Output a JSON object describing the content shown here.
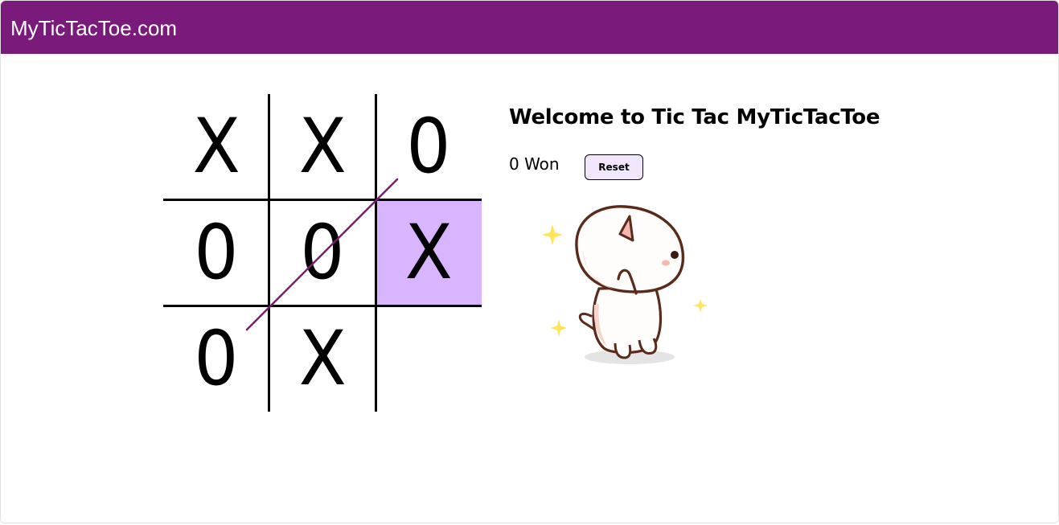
{
  "header": {
    "site_title": "MyTicTacToe.com"
  },
  "board": {
    "cells": [
      "X",
      "X",
      "0",
      "0",
      "0",
      "X",
      "0",
      "X",
      ""
    ],
    "highlighted_cell": 5,
    "winning_line": "diagonal from top-right to bottom-left"
  },
  "panel": {
    "welcome_text": "Welcome to Tic Tac MyTicTacToe",
    "status_text": "0 Won",
    "reset_label": "Reset"
  },
  "colors": {
    "header_bg": "#7a1a7b",
    "highlight": "#dab5ff",
    "strike_line": "#7a1a7b",
    "reset_bg": "#f1e6fb"
  },
  "mascot": {
    "icon": "dancing-cat-sticker-icon"
  }
}
